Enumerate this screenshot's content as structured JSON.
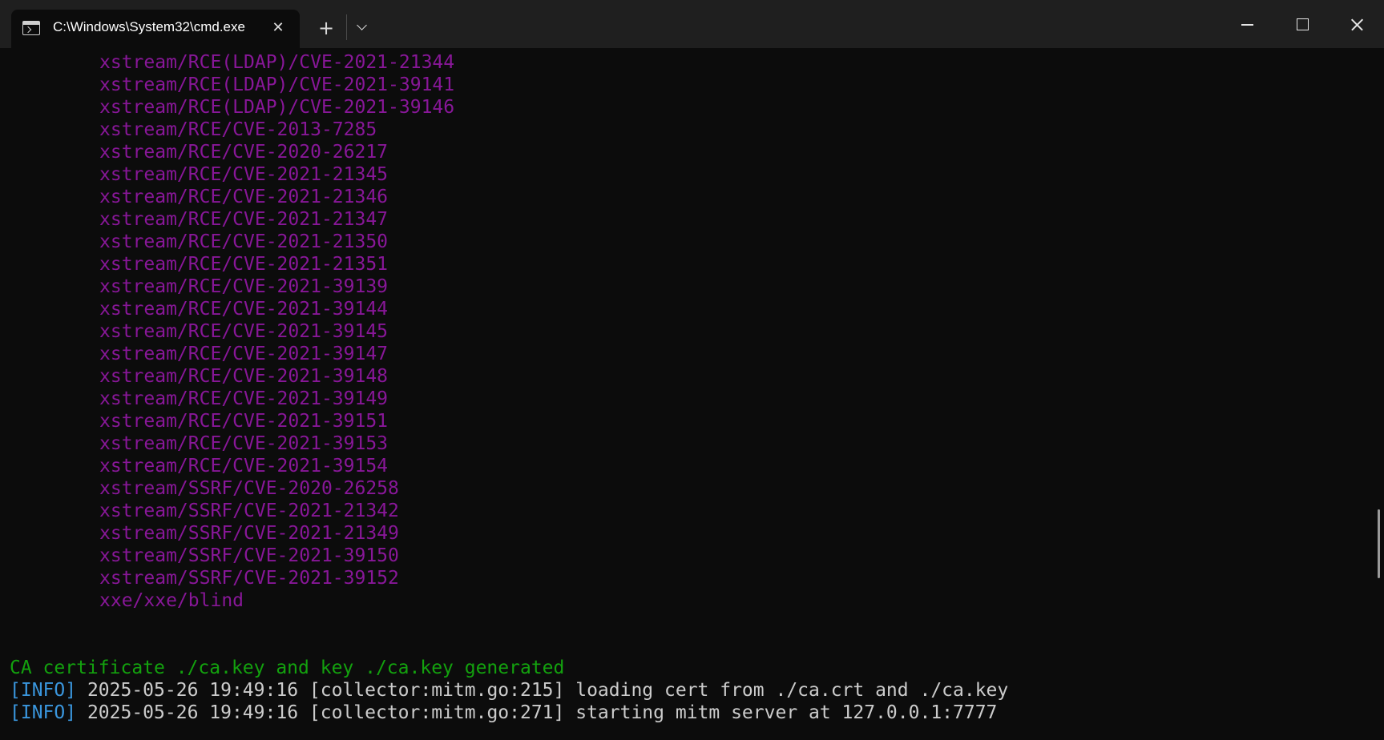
{
  "window": {
    "tab_title": "C:\\Windows\\System32\\cmd.exe",
    "tab_icon": "terminal-icon",
    "close_tab_icon": "close-icon",
    "new_tab_icon": "plus-icon",
    "dropdown_icon": "chevron-down-icon",
    "minimize_icon": "minimize-icon",
    "maximize_icon": "maximize-icon",
    "close_window_icon": "close-icon"
  },
  "terminal": {
    "list_items": [
      "xstream/RCE(LDAP)/CVE-2021-21344",
      "xstream/RCE(LDAP)/CVE-2021-39141",
      "xstream/RCE(LDAP)/CVE-2021-39146",
      "xstream/RCE/CVE-2013-7285",
      "xstream/RCE/CVE-2020-26217",
      "xstream/RCE/CVE-2021-21345",
      "xstream/RCE/CVE-2021-21346",
      "xstream/RCE/CVE-2021-21347",
      "xstream/RCE/CVE-2021-21350",
      "xstream/RCE/CVE-2021-21351",
      "xstream/RCE/CVE-2021-39139",
      "xstream/RCE/CVE-2021-39144",
      "xstream/RCE/CVE-2021-39145",
      "xstream/RCE/CVE-2021-39147",
      "xstream/RCE/CVE-2021-39148",
      "xstream/RCE/CVE-2021-39149",
      "xstream/RCE/CVE-2021-39151",
      "xstream/RCE/CVE-2021-39153",
      "xstream/RCE/CVE-2021-39154",
      "xstream/SSRF/CVE-2020-26258",
      "xstream/SSRF/CVE-2021-21342",
      "xstream/SSRF/CVE-2021-21349",
      "xstream/SSRF/CVE-2021-39150",
      "xstream/SSRF/CVE-2021-39152",
      "xxe/xxe/blind"
    ],
    "ca_message": "CA certificate ./ca.key and key ./ca.key generated",
    "log_lines": [
      {
        "level": "[INFO]",
        "text": " 2025-05-26 19:49:16 [collector:mitm.go:215] loading cert from ./ca.crt and ./ca.key"
      },
      {
        "level": "[INFO]",
        "text": " 2025-05-26 19:49:16 [collector:mitm.go:271] starting mitm server at 127.0.0.1:7777"
      }
    ]
  },
  "colors": {
    "background": "#0c0c0c",
    "titlebar": "#1f1f1f",
    "list_text": "#881798",
    "success_text": "#13a10e",
    "info_tag": "#3a96dd",
    "log_text": "#cccccc"
  }
}
